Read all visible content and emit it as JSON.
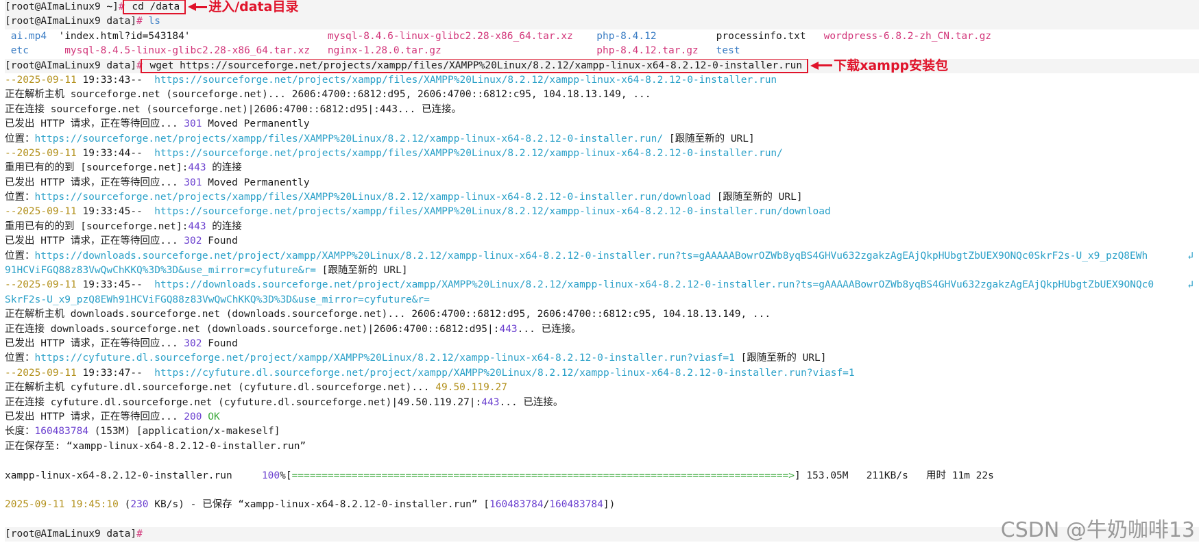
{
  "colors": {
    "text": "#1a1a1a",
    "dim": "#4b4b4b",
    "prompt_hash": "#d2367a",
    "url": "#2aa0c8",
    "number": "#6a3fcf",
    "datetime": "#b3911d",
    "blue": "#3b7dc4",
    "green": "#3aa83a",
    "annotation": "#e0142b"
  },
  "annotations": {
    "cd": "进入/data目录",
    "wget": "下载xampp安装包"
  },
  "watermark": "CSDN @牛奶咖啡13",
  "terminal": {
    "lines": [
      {
        "shaded": true,
        "segments": [
          {
            "t": "[root@AImaLinux9 ~]",
            "c": "text"
          },
          {
            "t": "#",
            "c": "prompt_hash"
          },
          {
            "t": " cd /data",
            "c": "text",
            "box": "cd"
          }
        ]
      },
      {
        "shaded": true,
        "segments": [
          {
            "t": "[root@AImaLinux9 data]",
            "c": "text"
          },
          {
            "t": "#",
            "c": "prompt_hash"
          },
          {
            "t": " ls",
            "c": "blue"
          }
        ]
      },
      {
        "segments": [
          {
            "t": " ai.mp4",
            "c": "blue",
            "w": 9
          },
          {
            "t": "'index.html?id=543184'",
            "c": "text",
            "w": 45
          },
          {
            "t": "mysql-8.4.6-linux-glibc2.28-x86_64.tar.xz",
            "c": "prompt_hash",
            "w": 45
          },
          {
            "t": "php-8.4.12",
            "c": "blue",
            "w": 20
          },
          {
            "t": "processinfo.txt",
            "c": "text",
            "w": 18
          },
          {
            "t": "wordpress-6.8.2-zh_CN.tar.gz",
            "c": "prompt_hash"
          }
        ]
      },
      {
        "segments": [
          {
            "t": " etc",
            "c": "blue",
            "w": 10
          },
          {
            "t": "mysql-8.4.5-linux-glibc2.28-x86_64.tar.xz",
            "c": "prompt_hash",
            "w": 44
          },
          {
            "t": "nginx-1.28.0.tar.gz",
            "c": "prompt_hash",
            "w": 45
          },
          {
            "t": "php-8.4.12.tar.gz",
            "c": "prompt_hash",
            "w": 20
          },
          {
            "t": "test",
            "c": "blue"
          }
        ]
      },
      {
        "shaded": true,
        "segments": [
          {
            "t": "[root@AImaLinux9 data]",
            "c": "text"
          },
          {
            "t": "#",
            "c": "prompt_hash"
          },
          {
            "t": " wget https://sourceforge.net/projects/xampp/files/XAMPP%20Linux/8.2.12/xampp-linux-x64-8.2.12-0-installer.run",
            "c": "text",
            "box": "wget"
          }
        ]
      },
      {
        "segments": [
          {
            "t": "--2025-09-11 ",
            "c": "datetime"
          },
          {
            "t": "19:33:43--  ",
            "c": "text"
          },
          {
            "t": "https://sourceforge.net/projects/xampp/files/XAMPP%20Linux/8.2.12/xampp-linux-x64-8.2.12-0-installer.run",
            "c": "url"
          }
        ]
      },
      {
        "segments": [
          {
            "t": "正在解析主机 sourceforge.net (sourceforge.net)... ",
            "c": "text"
          },
          {
            "t": "2606:4700::6812:d95, 2606:4700::6812:c95, 104.18.13.149, ...",
            "c": "text"
          }
        ]
      },
      {
        "segments": [
          {
            "t": "正在连接 sourceforge.net (sourceforge.net)|2606:4700::6812:d95|:443... 已连接。",
            "c": "text"
          }
        ]
      },
      {
        "segments": [
          {
            "t": "已发出 HTTP 请求，正在等待回应... ",
            "c": "text"
          },
          {
            "t": "301",
            "c": "number"
          },
          {
            "t": " Moved Permanently",
            "c": "text"
          }
        ]
      },
      {
        "segments": [
          {
            "t": "位置：",
            "c": "text"
          },
          {
            "t": "https://sourceforge.net/projects/xampp/files/XAMPP%20Linux/8.2.12/xampp-linux-x64-8.2.12-0-installer.run/",
            "c": "url"
          },
          {
            "t": " [跟随至新的 URL]",
            "c": "text"
          }
        ]
      },
      {
        "segments": [
          {
            "t": "--2025-09-11 ",
            "c": "datetime"
          },
          {
            "t": "19:33:44--  ",
            "c": "text"
          },
          {
            "t": "https://sourceforge.net/projects/xampp/files/XAMPP%20Linux/8.2.12/xampp-linux-x64-8.2.12-0-installer.run/",
            "c": "url"
          }
        ]
      },
      {
        "segments": [
          {
            "t": "重用已有的的到 [sourceforge.net]:",
            "c": "text"
          },
          {
            "t": "443",
            "c": "number"
          },
          {
            "t": " 的连接",
            "c": "text"
          }
        ]
      },
      {
        "segments": [
          {
            "t": "已发出 HTTP 请求，正在等待回应... ",
            "c": "text"
          },
          {
            "t": "301",
            "c": "number"
          },
          {
            "t": " Moved Permanently",
            "c": "text"
          }
        ]
      },
      {
        "segments": [
          {
            "t": "位置：",
            "c": "text"
          },
          {
            "t": "https://sourceforge.net/projects/xampp/files/XAMPP%20Linux/8.2.12/xampp-linux-x64-8.2.12-0-installer.run/download",
            "c": "url"
          },
          {
            "t": " [跟随至新的 URL]",
            "c": "text"
          }
        ]
      },
      {
        "segments": [
          {
            "t": "--2025-09-11 ",
            "c": "datetime"
          },
          {
            "t": "19:33:45--  ",
            "c": "text"
          },
          {
            "t": "https://sourceforge.net/projects/xampp/files/XAMPP%20Linux/8.2.12/xampp-linux-x64-8.2.12-0-installer.run/download",
            "c": "url"
          }
        ]
      },
      {
        "segments": [
          {
            "t": "重用已有的的到 [sourceforge.net]:",
            "c": "text"
          },
          {
            "t": "443",
            "c": "number"
          },
          {
            "t": " 的连接",
            "c": "text"
          }
        ]
      },
      {
        "segments": [
          {
            "t": "已发出 HTTP 请求，正在等待回应... ",
            "c": "text"
          },
          {
            "t": "302",
            "c": "number"
          },
          {
            "t": " Found",
            "c": "text"
          }
        ]
      },
      {
        "wrap": true,
        "segments": [
          {
            "t": "位置：",
            "c": "text"
          },
          {
            "t": "https://downloads.sourceforge.net/project/xampp/XAMPP%20Linux/8.2.12/xampp-linux-x64-8.2.12-0-installer.run?ts=gAAAAABowrOZWb8yqBS4GHVu632zgakzAgEAjQkpHUbgtZbUEX9ONQc0SkrF2s-U_x9_pzQ8EWh",
            "c": "url"
          }
        ]
      },
      {
        "segments": [
          {
            "t": "91HCViFGQ88z83VwQwChKKQ%3D%3D&use_mirror=cyfuture&r=",
            "c": "url"
          },
          {
            "t": " [跟随至新的 URL]",
            "c": "text"
          }
        ]
      },
      {
        "wrap": true,
        "segments": [
          {
            "t": "--2025-09-11 ",
            "c": "datetime"
          },
          {
            "t": "19:33:45--  ",
            "c": "text"
          },
          {
            "t": "https://downloads.sourceforge.net/project/xampp/XAMPP%20Linux/8.2.12/xampp-linux-x64-8.2.12-0-installer.run?ts=gAAAAABowrOZWb8yqBS4GHVu632zgakzAgEAjQkpHUbgtZbUEX9ONQc0",
            "c": "url"
          }
        ]
      },
      {
        "segments": [
          {
            "t": "SkrF2s-U_x9_pzQ8EWh91HCViFGQ88z83VwQwChKKQ%3D%3D&use_mirror=cyfuture&r=",
            "c": "url"
          }
        ]
      },
      {
        "segments": [
          {
            "t": "正在解析主机 downloads.sourceforge.net (downloads.sourceforge.net)... 2606:4700::6812:d95, 2606:4700::6812:c95, 104.18.13.149, ...",
            "c": "text"
          }
        ]
      },
      {
        "segments": [
          {
            "t": "正在连接 downloads.sourceforge.net (downloads.sourceforge.net)|2606:4700::6812:d95|:",
            "c": "text"
          },
          {
            "t": "443",
            "c": "number"
          },
          {
            "t": "... 已连接。",
            "c": "text"
          }
        ]
      },
      {
        "segments": [
          {
            "t": "已发出 HTTP 请求，正在等待回应... ",
            "c": "text"
          },
          {
            "t": "302",
            "c": "number"
          },
          {
            "t": " Found",
            "c": "text"
          }
        ]
      },
      {
        "segments": [
          {
            "t": "位置：",
            "c": "text"
          },
          {
            "t": "https://cyfuture.dl.sourceforge.net/project/xampp/XAMPP%20Linux/8.2.12/xampp-linux-x64-8.2.12-0-installer.run?viasf=1",
            "c": "url"
          },
          {
            "t": " [跟随至新的 URL]",
            "c": "text"
          }
        ]
      },
      {
        "segments": [
          {
            "t": "--2025-09-11 ",
            "c": "datetime"
          },
          {
            "t": "19:33:47--  ",
            "c": "text"
          },
          {
            "t": "https://cyfuture.dl.sourceforge.net/project/xampp/XAMPP%20Linux/8.2.12/xampp-linux-x64-8.2.12-0-installer.run?viasf=1",
            "c": "url"
          }
        ]
      },
      {
        "segments": [
          {
            "t": "正在解析主机 cyfuture.dl.sourceforge.net (cyfuture.dl.sourceforge.net)... ",
            "c": "text"
          },
          {
            "t": "49.50.119.27",
            "c": "datetime"
          }
        ]
      },
      {
        "segments": [
          {
            "t": "正在连接 cyfuture.dl.sourceforge.net (cyfuture.dl.sourceforge.net)|49.50.119.27|:",
            "c": "text"
          },
          {
            "t": "443",
            "c": "number"
          },
          {
            "t": "... 已连接。",
            "c": "text"
          }
        ]
      },
      {
        "segments": [
          {
            "t": "已发出 HTTP 请求，正在等待回应... ",
            "c": "text"
          },
          {
            "t": "200",
            "c": "number"
          },
          {
            "t": " OK",
            "c": "green"
          }
        ]
      },
      {
        "segments": [
          {
            "t": "长度：",
            "c": "text"
          },
          {
            "t": "160483784",
            "c": "number"
          },
          {
            "t": " (153M) [application/x-makeself]",
            "c": "text"
          }
        ]
      },
      {
        "segments": [
          {
            "t": "正在保存至: “xampp-linux-x64-8.2.12-0-installer.run”",
            "c": "text"
          }
        ]
      },
      {
        "segments": [
          {
            "t": "",
            "c": "text"
          }
        ]
      },
      {
        "segments": [
          {
            "t": "xampp-linux-x64-8.2.12-0-installer.run",
            "c": "text",
            "w": 43
          },
          {
            "t": "100",
            "c": "number"
          },
          {
            "t": "%[",
            "c": "text"
          },
          {
            "t": "===================================================================================>",
            "c": "green"
          },
          {
            "t": "] 153.05M   211KB/s   用时 11m 22s",
            "c": "text"
          }
        ]
      },
      {
        "segments": [
          {
            "t": "",
            "c": "text"
          }
        ]
      },
      {
        "segments": [
          {
            "t": "2025-09-11 19:45:10",
            "c": "datetime"
          },
          {
            "t": " (",
            "c": "text"
          },
          {
            "t": "230",
            "c": "number"
          },
          {
            "t": " KB/s) - 已保存 “xampp-linux-x64-8.2.12-0-installer.run” [",
            "c": "text"
          },
          {
            "t": "160483784",
            "c": "number"
          },
          {
            "t": "/",
            "c": "text"
          },
          {
            "t": "160483784",
            "c": "number"
          },
          {
            "t": "])",
            "c": "text"
          }
        ]
      },
      {
        "segments": [
          {
            "t": "",
            "c": "text"
          }
        ]
      },
      {
        "shaded": true,
        "segments": [
          {
            "t": "[root@AImaLinux9 data]",
            "c": "text"
          },
          {
            "t": "#",
            "c": "prompt_hash"
          }
        ]
      }
    ]
  }
}
